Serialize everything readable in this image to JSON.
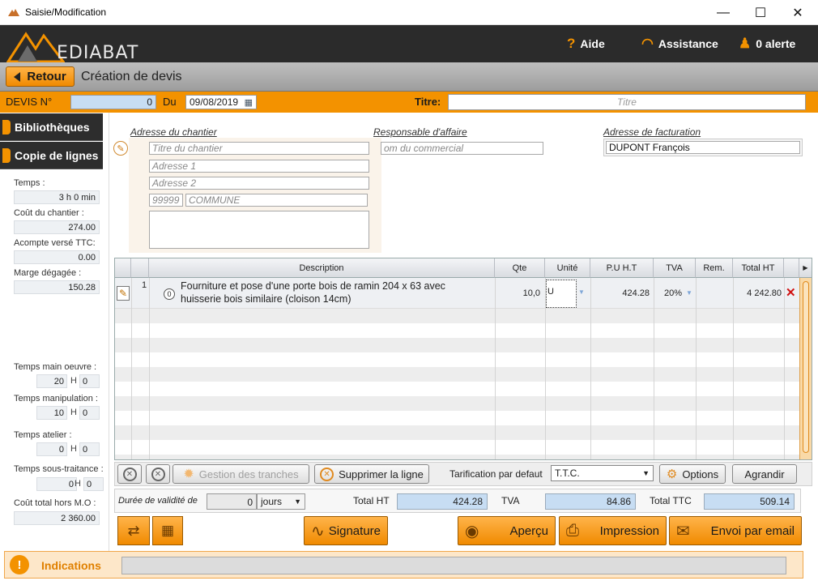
{
  "window": {
    "title": "Saisie/Modification",
    "minimize": "—",
    "maximize": "☐",
    "close": "✕"
  },
  "header": {
    "logo": "EDIABAT",
    "aide": "Aide",
    "assistance": "Assistance",
    "alerte": "0 alerte"
  },
  "nav": {
    "back_label": "Retour",
    "page_title": "Création de devis"
  },
  "devis": {
    "number_label": "DEVIS N°",
    "number": "0",
    "date_label": "Du",
    "date": "09/08/2019",
    "titre_label": "Titre:",
    "titre_placeholder": "Titre"
  },
  "sidebar": {
    "tabs": [
      "Bibliothèques",
      "Copie de lignes"
    ],
    "temps_label": "Temps :",
    "temps": "3 h 0 min",
    "cout_label": "Coût du chantier :",
    "cout": "274.00",
    "acompte_label": "Acompte versé TTC:",
    "acompte": "0.00",
    "marge_label": "Marge dégagée :",
    "marge": "150.28",
    "tmo_label": "Temps main oeuvre :",
    "tmo_h": "20",
    "tmo_m": "0",
    "tman_label": "Temps manipulation :",
    "tman_h": "10",
    "tman_m": "0",
    "tate_label": "Temps atelier :",
    "tate_h": "0",
    "tate_m": "0",
    "tst_label": "Temps sous-traitance :",
    "tst_h": "0",
    "tst_m": "0",
    "h_unit": "H",
    "ctmo_label": "Coût total hors M.O :",
    "ctmo": "2 360.00"
  },
  "address": {
    "chantier_title": "Adresse du chantier",
    "titre_ph": "Titre du chantier",
    "adr1_ph": "Adresse 1",
    "adr2_ph": "Adresse 2",
    "cp_ph": "99999",
    "commune_ph": "COMMUNE",
    "resp_title": "Responsable d'affaire",
    "commercial_ph": "om du commercial",
    "fact_title": "Adresse de facturation",
    "fact_value": "DUPONT François"
  },
  "table": {
    "headers": {
      "description": "Description",
      "qte": "Qte",
      "unite": "Unité",
      "pu": "P.U H.T",
      "tva": "TVA",
      "rem": "Rem.",
      "total": "Total HT"
    },
    "row": {
      "num": "1",
      "badge": "0",
      "desc1": "Fourniture et pose d'une porte bois de ramin 204 x 63 avec",
      "desc2": "huisserie bois similaire (cloison 14cm)",
      "qte": "10,0",
      "unite": "U",
      "pu": "424.28",
      "tva": "20%",
      "total": "4 242.80"
    }
  },
  "toolbar": {
    "tranches": "Gestion des tranches",
    "supprimer": "Supprimer la ligne",
    "tarif_label": "Tarification par defaut",
    "tarif_value": "T.T.C.",
    "options": "Options",
    "agrandir": "Agrandir"
  },
  "totals": {
    "validite_label": "Durée de validité de",
    "validite_value": "0",
    "validite_unit": "jours",
    "ht_label": "Total HT",
    "ht": "424.28",
    "tva_label": "TVA",
    "tva": "84.86",
    "ttc_label": "Total TTC",
    "ttc": "509.14"
  },
  "actions": {
    "signature": "Signature",
    "apercu": "Aperçu",
    "impression": "Impression",
    "email": "Envoi par email"
  },
  "indications": {
    "label": "Indications"
  },
  "colors": {
    "accent": "#f39200",
    "dark": "#2b2b2b",
    "blue_field": "#c7ddf3"
  }
}
